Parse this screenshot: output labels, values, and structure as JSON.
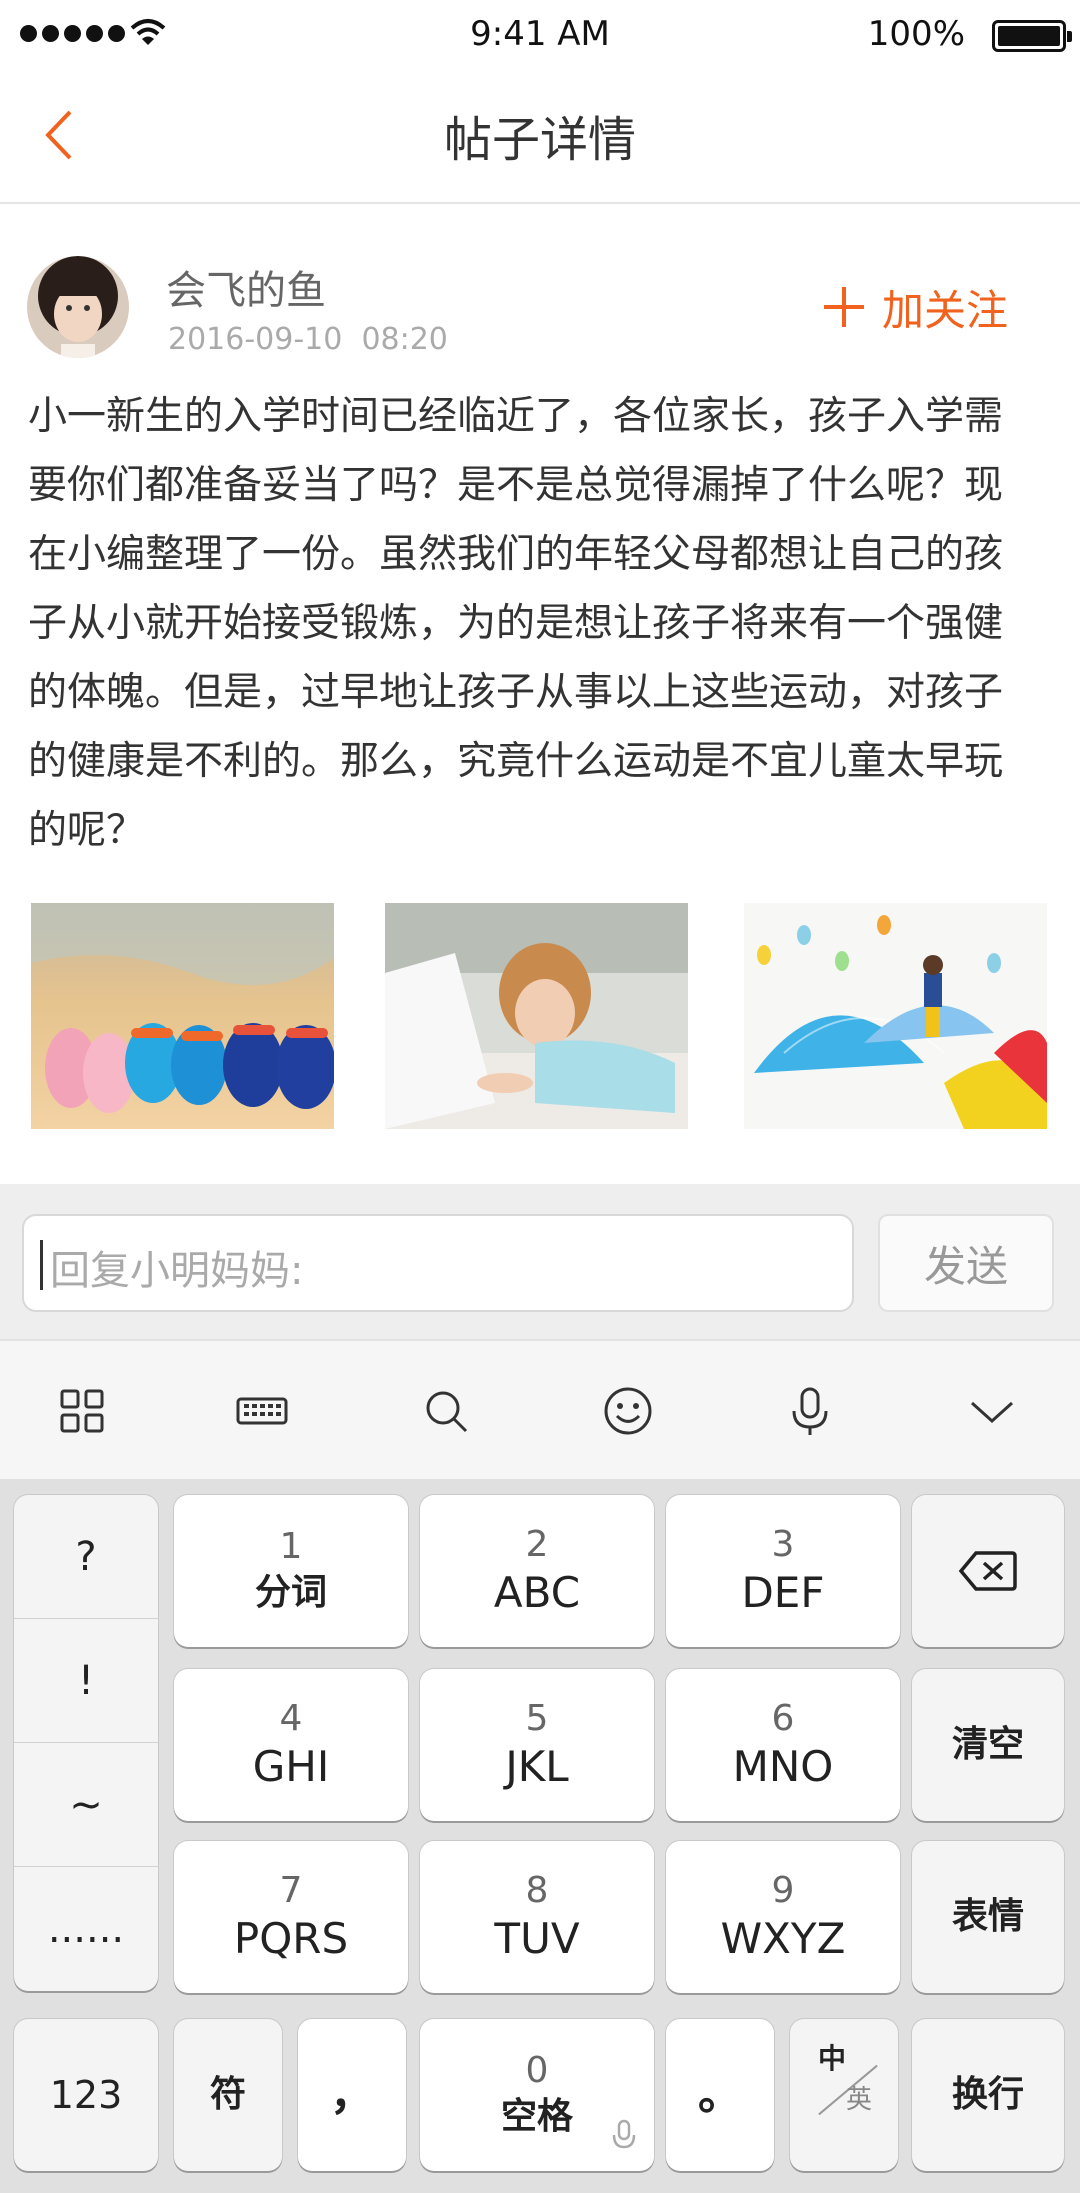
{
  "status_bar": {
    "time": "9:41 AM",
    "battery": "100%"
  },
  "nav": {
    "title": "帖子详情"
  },
  "post": {
    "author": "会飞的鱼",
    "date": "2016-09-10",
    "time": "08:20",
    "follow_label": "加关注",
    "body_lines": [
      "小一新生的入学时间已经临近了，各位家长，孩子入学需",
      "要你们都准备妥当了吗？是不是总觉得漏掉了什么呢？现",
      "在小编整理了一份。虽然我们的年轻父母都想让自己的孩",
      "子从小就开始接受锻炼，为的是想让孩子将来有一个强健",
      "的体魄。但是，过早地让孩子从事以上这些运动，对孩子",
      "的健康是不利的。那么，究竟什么运动是不宜儿童太早玩",
      "的呢？"
    ]
  },
  "reply": {
    "placeholder": "回复小明妈妈:",
    "send_label": "发送"
  },
  "keyboard": {
    "toolbar_icons": [
      "grid-icon",
      "keyboard-icon",
      "search-icon",
      "emoji-icon",
      "microphone-icon",
      "chevron-down-icon"
    ],
    "symbols": [
      "?",
      "!",
      "~",
      "......"
    ],
    "keys": [
      {
        "num": "1",
        "label": "分词"
      },
      {
        "num": "2",
        "label": "ABC"
      },
      {
        "num": "3",
        "label": "DEF"
      },
      {
        "num": "4",
        "label": "GHI"
      },
      {
        "num": "5",
        "label": "JKL"
      },
      {
        "num": "6",
        "label": "MNO"
      },
      {
        "num": "7",
        "label": "PQRS"
      },
      {
        "num": "8",
        "label": "TUV"
      },
      {
        "num": "9",
        "label": "WXYZ"
      }
    ],
    "clear_label": "清空",
    "emoji_label": "表情",
    "bottom": {
      "num_label": "123",
      "symbol_label": "符",
      "comma_label": "，",
      "space_num": "0",
      "space_label": "空格",
      "period_label": "。",
      "cn_label": "中",
      "en_label": "英",
      "enter_label": "换行"
    }
  },
  "colors": {
    "accent": "#f0621d",
    "keyboard_bg": "#e0e0e0"
  }
}
